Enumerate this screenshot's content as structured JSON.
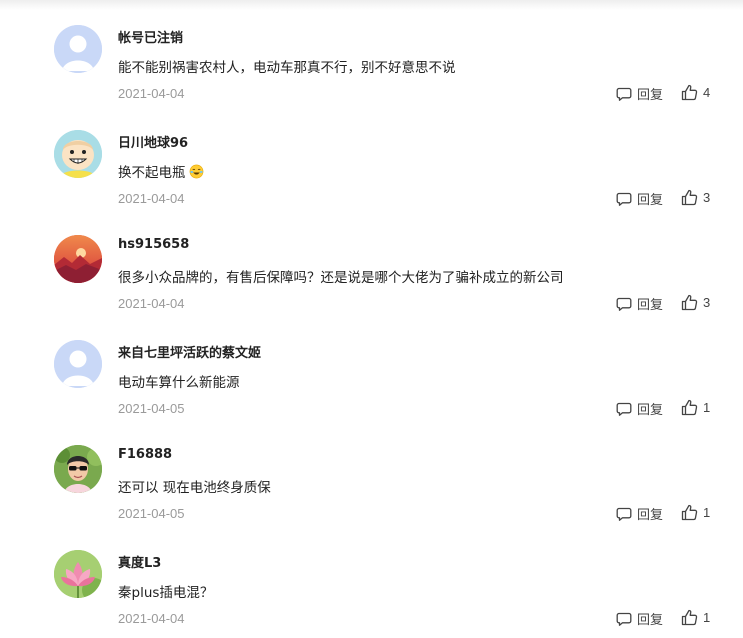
{
  "reply_label": "回复",
  "colors": {
    "username": "#222222",
    "content": "#222222",
    "date": "#9a9a9a",
    "action": "#444444"
  },
  "comments": [
    {
      "username": "帐号已注销",
      "content": "能不能别祸害农村人，电动车那真不行，别不好意思不说",
      "date": "2021-04-04",
      "likes": "4",
      "avatar": "default-avatar"
    },
    {
      "username": "日川地球96",
      "content": "换不起电瓶",
      "emoji": "crying-laughing-emoji",
      "date": "2021-04-04",
      "likes": "3",
      "avatar": "cartoon-face-avatar"
    },
    {
      "username": "hs915658",
      "content": "很多小众品牌的，有售后保障吗？还是说是哪个大佬为了骗补成立的新公司",
      "date": "2021-04-04",
      "likes": "3",
      "avatar": "sunset-avatar"
    },
    {
      "username": "来自七里坪活跃的蔡文姬",
      "content": "电动车算什么新能源",
      "date": "2021-04-05",
      "likes": "1",
      "avatar": "default-avatar"
    },
    {
      "username": "F16888",
      "content": "还可以 现在电池终身质保",
      "date": "2021-04-05",
      "likes": "1",
      "avatar": "photo-avatar"
    },
    {
      "username": "真度L3",
      "content": "秦plus插电混？",
      "date": "2021-04-04",
      "likes": "1",
      "avatar": "lotus-avatar"
    }
  ]
}
